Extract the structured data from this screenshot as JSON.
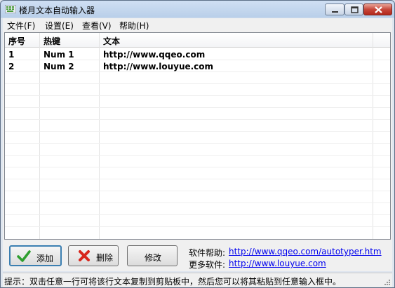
{
  "window": {
    "title": "楼月文本自动输入器"
  },
  "menu": [
    {
      "label": "文件(F)"
    },
    {
      "label": "设置(E)"
    },
    {
      "label": "查看(V)"
    },
    {
      "label": "帮助(H)"
    }
  ],
  "list": {
    "columns": [
      "序号",
      "热键",
      "文本"
    ],
    "rows": [
      {
        "index": "1",
        "hotkey": "Num 1",
        "text": "http://www.qqeo.com"
      },
      {
        "index": "2",
        "hotkey": "Num 2",
        "text": "http://www.louyue.com"
      }
    ]
  },
  "buttons": {
    "add": "添加",
    "delete": "删除",
    "edit": "修改"
  },
  "info": {
    "help_label": "软件帮助:",
    "help_link": "http://www.qqeo.com/autotyper.htm",
    "more_label": "更多软件:",
    "more_link": "http://www.louyue.com"
  },
  "status": "提示：双击任意一行可将该行文本复制到剪贴板中，然后您可以将其粘贴到任意输入框中。",
  "icons": [
    "app-icon",
    "minimize-icon",
    "maximize-icon",
    "close-icon",
    "checkmark-icon",
    "red-x-icon",
    "size-grip-icon"
  ],
  "colors": {
    "link": "#0000ee",
    "title_bar": "#b9cfe9",
    "close_button": "#c7473a"
  }
}
